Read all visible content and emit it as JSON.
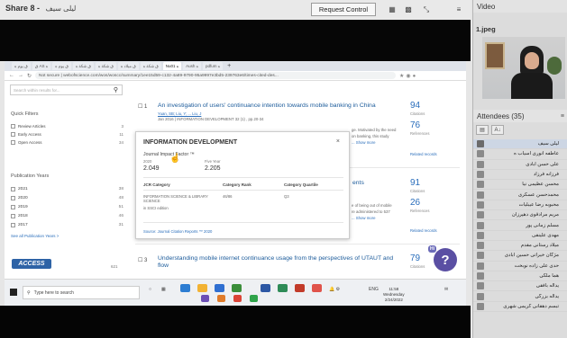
{
  "share": {
    "title": "Share 8 -",
    "presenter": "ليلى سيف",
    "request_control": "Request Control",
    "icons": [
      "tile-icon",
      "grid-icon",
      "fullscreen-icon",
      "menu-icon"
    ]
  },
  "browser": {
    "tabs": [
      "ق يوم ه",
      "ق AS ه",
      "ق يوم ه",
      "ق شكة ه",
      "ق شكة ه",
      "ق ميلاد ه",
      "ق شكة ه",
      "Nu01 ه",
      "Aush ه",
      "pdfum ه"
    ],
    "url": "Not secure | webofscience.com/wos/woscc/summary/1ee15d59-c132-4a89-9790-95a9997e3bd5-239763e6/times-cited-des...",
    "search_placeholder": "Search within results for..."
  },
  "sidebar": {
    "quick_filters_title": "Quick Filters",
    "quick_filters": [
      {
        "label": "Review Articles",
        "count": "3"
      },
      {
        "label": "Early Access",
        "count": "11"
      },
      {
        "label": "Open Access",
        "count": "34"
      }
    ],
    "years_title": "Publication Years",
    "years": [
      {
        "label": "2021",
        "count": "38"
      },
      {
        "label": "2020",
        "count": "48"
      },
      {
        "label": "2019",
        "count": "51"
      },
      {
        "label": "2018",
        "count": "46"
      },
      {
        "label": "2017",
        "count": "31"
      }
    ],
    "see_all": "See all Publication Years >",
    "extra_count": "621"
  },
  "results": [
    {
      "num": "1",
      "title": "An investigation of users' continuance intention towards mobile banking in China",
      "authors": "Yuan, SB; Liu, Y; ... Liu, J",
      "source": "Jan 2016 | INFORMATION DEVELOPMENT 32 (1) , pp.20-34",
      "snippet_a": "ge. Motivated by the need",
      "snippet_b": "on banking, this study",
      "show_more": "... Show more",
      "citations": "94",
      "citations_label": "Citations",
      "references": "76",
      "references_label": "References",
      "related": "Related records"
    },
    {
      "num": "2",
      "title_tail": "ents",
      "snippet_a": "e of being out of mobile",
      "snippet_b": "re administered to 537",
      "show_more": "... Show more",
      "citations": "91",
      "citations_label": "Citations",
      "references": "26",
      "references_label": "References",
      "related": "Related records"
    },
    {
      "num": "3",
      "title": "Understanding mobile internet continuance usage from the perspectives of UTAUT and flow",
      "citations": "79",
      "citations_label": "Citations"
    }
  ],
  "popup": {
    "title": "INFORMATION DEVELOPMENT",
    "close": "×",
    "jif_label": "Journal Impact Factor ™",
    "year_2020": "2020",
    "val_2020": "2.049",
    "five_year_label": "Five Year",
    "val_five_year": "2.205",
    "col_category": "JCR Category",
    "col_rank": "Category Rank",
    "col_quartile": "Category Quartile",
    "row_category": "INFORMATION SCIENCE & LIBRARY SCIENCE",
    "row_edition": "in SSCI edition",
    "row_rank": "46/86",
    "row_quartile": "Q3",
    "source": "Source: Journal Citation Reports ™ 2020"
  },
  "taskbar": {
    "search": "Type here to search",
    "time": "11:58",
    "day": "Wednesday",
    "date": "2/24/2022",
    "lang": "ENG"
  },
  "help": {
    "badge": "Hi",
    "icon": "?"
  },
  "video": {
    "header": "Video",
    "file": "1.jpeg"
  },
  "attendees": {
    "header": "Attendees",
    "count": "(35)",
    "names": [
      "ليلى سيف",
      "عاطفه انوری اسیاب ه",
      "علی حسن آبادی",
      "فرزانه فرزاد",
      "محسن عظیمی نیا",
      "محمدحسن عسکری",
      "محبوبه رضا عیبلیات",
      "مریم مرادقوی دهپرزان",
      "مسلم زمانی پور",
      "مهدی علینقی",
      "میلاد رستانی مقدم",
      "مژگان خیراتی حسین ابادی",
      "حدی علی زاده نوبخت",
      "هما ملکی",
      "یداله بافقی",
      "یداله بزرگی",
      "تبسم دهقانی کریمی شهری"
    ]
  },
  "colors": {
    "link": "#2a6ebb",
    "attendee_highlight": "#cdd6e4",
    "help_button": "#5a4fa3"
  }
}
